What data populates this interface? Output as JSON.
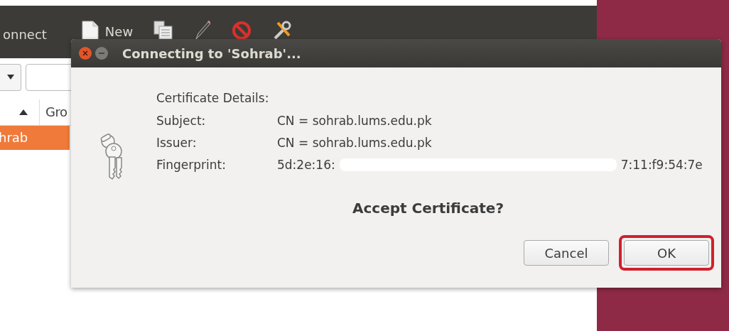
{
  "app": {
    "toolbar": [
      {
        "kind": "text",
        "label": "onnect"
      },
      {
        "kind": "new",
        "label": "New"
      },
      {
        "kind": "copy"
      },
      {
        "kind": "edit"
      },
      {
        "kind": "stop"
      },
      {
        "kind": "tools"
      }
    ],
    "column_header": {
      "label": "Gro"
    },
    "rows": [
      {
        "label": "hrab",
        "selected": true
      }
    ]
  },
  "dialog": {
    "title": "Connecting to 'Sohrab'...",
    "heading": "Certificate Details:",
    "fields": [
      {
        "label": "Subject:",
        "value": "CN = sohrab.lums.edu.pk"
      },
      {
        "label": "Issuer:",
        "value": "CN = sohrab.lums.edu.pk"
      },
      {
        "label": "Fingerprint:",
        "value_start": "5d:2e:16:",
        "value_end": "7:11:f9:54:7e",
        "redacted": true
      }
    ],
    "question": "Accept Certificate?",
    "buttons": [
      {
        "label": "Cancel",
        "highlighted": false
      },
      {
        "label": "OK",
        "highlighted": true
      }
    ]
  }
}
